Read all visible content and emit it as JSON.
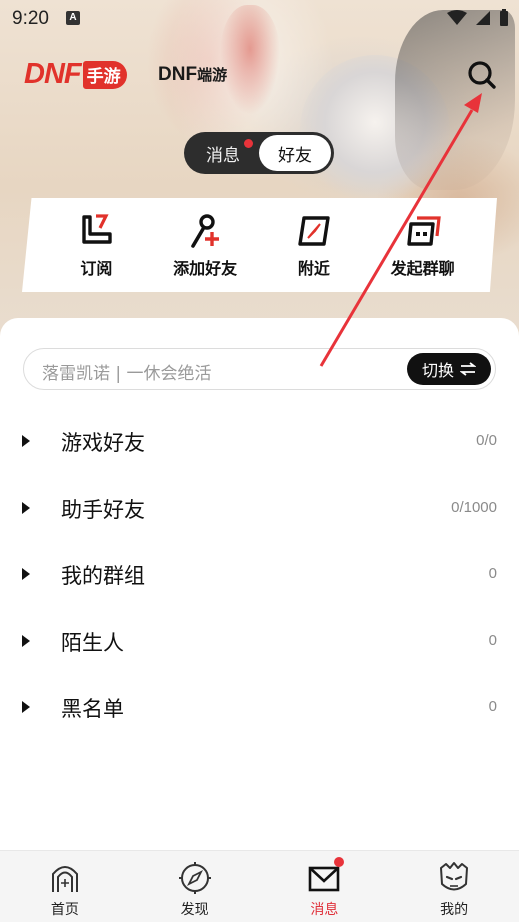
{
  "status_bar": {
    "time": "9:20",
    "notification_icon": "A"
  },
  "header": {
    "logo_mobile_brand": "DNF",
    "logo_mobile_suffix": "手游",
    "logo_pc_brand": "DNF",
    "logo_pc_suffix": "端游",
    "search_icon": "search-icon"
  },
  "segmented": {
    "tabs": [
      {
        "label": "消息",
        "active": false,
        "badge": true
      },
      {
        "label": "好友",
        "active": true,
        "badge": false
      }
    ]
  },
  "actions": [
    {
      "label": "订阅",
      "icon": "subscribe-icon"
    },
    {
      "label": "添加好友",
      "icon": "add-friend-icon"
    },
    {
      "label": "附近",
      "icon": "nearby-icon"
    },
    {
      "label": "发起群聊",
      "icon": "group-chat-icon"
    }
  ],
  "search": {
    "placeholder": "落雷凯诺 | 一休会绝活",
    "switch_label": "切换"
  },
  "groups": [
    {
      "name": "游戏好友",
      "count": "0/0"
    },
    {
      "name": "助手好友",
      "count": "0/1000"
    },
    {
      "name": "我的群组",
      "count": "0"
    },
    {
      "name": "陌生人",
      "count": "0"
    },
    {
      "name": "黑名单",
      "count": "0"
    }
  ],
  "bottom_nav": [
    {
      "label": "首页",
      "icon": "home-gate-icon",
      "active": false
    },
    {
      "label": "发现",
      "icon": "compass-icon",
      "active": false
    },
    {
      "label": "消息",
      "icon": "mail-icon",
      "active": true,
      "badge": true
    },
    {
      "label": "我的",
      "icon": "profile-mask-icon",
      "active": false
    }
  ],
  "colors": {
    "accent_red": "#e1322b",
    "badge_red": "#e8333a",
    "dark": "#2d2d2d"
  }
}
